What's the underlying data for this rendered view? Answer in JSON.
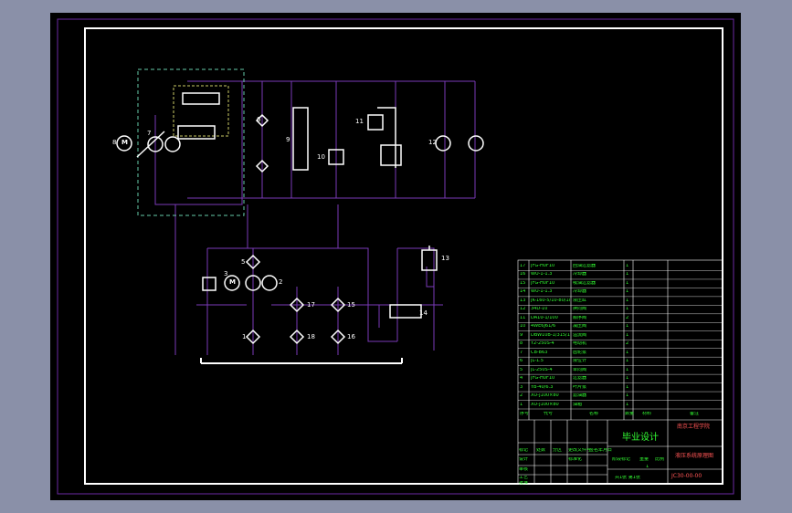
{
  "colors": {
    "background": "#8a90a8",
    "sheet": "#000000",
    "frame": "#ffffff",
    "border": "#6b2aa3",
    "lines": "#7a3ab8",
    "components": "#ffffff",
    "text_white": "#ffffff",
    "text_green": "#33ff33",
    "text_red": "#ff5555"
  },
  "labels": {
    "l1": "1",
    "l2": "2",
    "l3": "3",
    "l5": "5",
    "l6": "6",
    "l7": "7",
    "l8": "8",
    "l9": "9",
    "l10": "10",
    "l11": "11",
    "l12": "12",
    "l13": "13",
    "l14": "14",
    "l15": "15",
    "l16": "16",
    "l17": "17",
    "l18": "18"
  },
  "pump_letter": "M",
  "bom": [
    {
      "no": "17",
      "code": "JFG-H0F10",
      "name": "回油过滤器",
      "qty": "1"
    },
    {
      "no": "16",
      "code": "WU-1-1.3",
      "name": "冷却器",
      "qty": "1"
    },
    {
      "no": "15",
      "code": "JFG-H0F10",
      "name": "吸油过滤器",
      "qty": "1"
    },
    {
      "no": "14",
      "code": "WU-1-1.3",
      "name": "冷却器",
      "qty": "1"
    },
    {
      "no": "13",
      "code": "JK-160-5/10-80/10",
      "name": "液压缸",
      "qty": "1"
    },
    {
      "no": "12",
      "code": "34D-10",
      "name": "换向阀",
      "qty": "1"
    },
    {
      "no": "11",
      "code": "DA10-1/100",
      "name": "顺序阀",
      "qty": "2"
    },
    {
      "no": "10",
      "code": "4WE6J61/6",
      "name": "减压阀",
      "qty": "1"
    },
    {
      "no": "9",
      "code": "DBW10B-1/315/10",
      "name": "溢流阀",
      "qty": "1"
    },
    {
      "no": "8",
      "code": "Y2-250S-4",
      "name": "电动机",
      "qty": "2"
    },
    {
      "no": "7",
      "code": "CB-B63",
      "name": "齿轮泵",
      "qty": "1"
    },
    {
      "no": "6",
      "code": "JL-1.5",
      "name": "液位计",
      "qty": "1"
    },
    {
      "no": "5",
      "code": "JL-250S-4",
      "name": "单向阀",
      "qty": "1"
    },
    {
      "no": "4",
      "code": "JFG-H0F10",
      "name": "过滤器",
      "qty": "1"
    },
    {
      "no": "3",
      "code": "YB-40/6.3",
      "name": "叶片泵",
      "qty": "1"
    },
    {
      "no": "2",
      "code": "XU-J100×80",
      "name": "滤油器",
      "qty": "1"
    },
    {
      "no": "1",
      "code": "XU-J100×80",
      "name": "油箱",
      "qty": "1"
    }
  ],
  "bom_header": {
    "no": "序号",
    "code": "代号",
    "name": "名称",
    "qty": "数量",
    "material": "材料",
    "note": "备注"
  },
  "title_block": {
    "design_title": "毕业设计",
    "school": "南京工程学院",
    "drawing_name": "液压系统原理图",
    "drawing_no": "JC30-00-00",
    "stage_label": "阶段标记",
    "weight_label": "重量",
    "scale_label": "比例",
    "scale": "1",
    "sheet_info": "共1张 第1张",
    "rows": [
      "标记",
      "设计",
      "审核",
      "工艺",
      "批准"
    ],
    "cols": [
      "处数",
      "分区",
      "更改文件号",
      "签名",
      "年月日"
    ],
    "std_label": "标准化"
  }
}
